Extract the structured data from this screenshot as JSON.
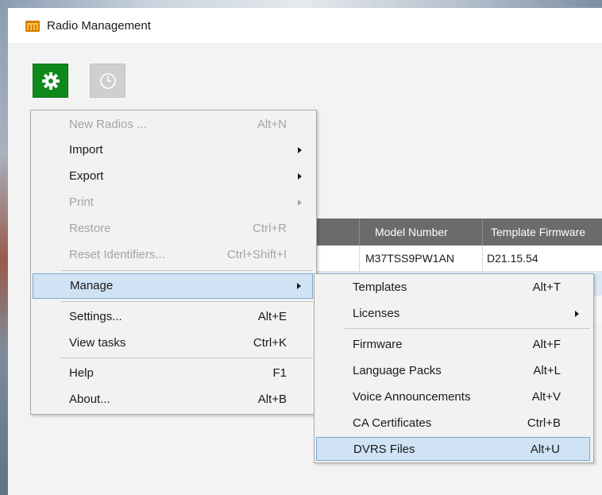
{
  "window": {
    "title": "Radio Management"
  },
  "toolbar": {
    "settings_icon": "gear-icon",
    "tasks_icon": "clock-icon"
  },
  "colors": {
    "accent_green": "#0f8a1a",
    "highlight": "#cfe3f5",
    "header": "#6b6b6b"
  },
  "table": {
    "headers": [
      "Model Number",
      "Template Firmware"
    ],
    "rows": [
      {
        "model": "M37TSS9PW1AN",
        "firmware": "D21.15.54"
      }
    ]
  },
  "main_menu": {
    "items": [
      {
        "label": "New Radios ...",
        "shortcut": "Alt+N",
        "disabled": true
      },
      {
        "label": "Import",
        "shortcut": "",
        "submenu": true
      },
      {
        "label": "Export",
        "shortcut": "",
        "submenu": true
      },
      {
        "label": "Print",
        "shortcut": "",
        "submenu": true,
        "disabled": true
      },
      {
        "label": "Restore",
        "shortcut": "Ctrl+R",
        "disabled": true
      },
      {
        "label": "Reset Identifiers...",
        "shortcut": "Ctrl+Shift+I",
        "disabled": true
      },
      {
        "label": "Manage",
        "shortcut": "",
        "submenu": true,
        "highlighted": true
      },
      {
        "label": "Settings...",
        "shortcut": "Alt+E"
      },
      {
        "label": "View tasks",
        "shortcut": "Ctrl+K"
      },
      {
        "label": "Help",
        "shortcut": "F1"
      },
      {
        "label": "About...",
        "shortcut": "Alt+B"
      }
    ]
  },
  "manage_submenu": {
    "items": [
      {
        "label": "Templates",
        "shortcut": "Alt+T"
      },
      {
        "label": "Licenses",
        "shortcut": "",
        "submenu": true
      },
      {
        "label": "Firmware",
        "shortcut": "Alt+F"
      },
      {
        "label": "Language Packs",
        "shortcut": "Alt+L"
      },
      {
        "label": "Voice Announcements",
        "shortcut": "Alt+V"
      },
      {
        "label": "CA Certificates",
        "shortcut": "Ctrl+B"
      },
      {
        "label": "DVRS Files",
        "shortcut": "Alt+U",
        "highlighted": true
      }
    ]
  }
}
